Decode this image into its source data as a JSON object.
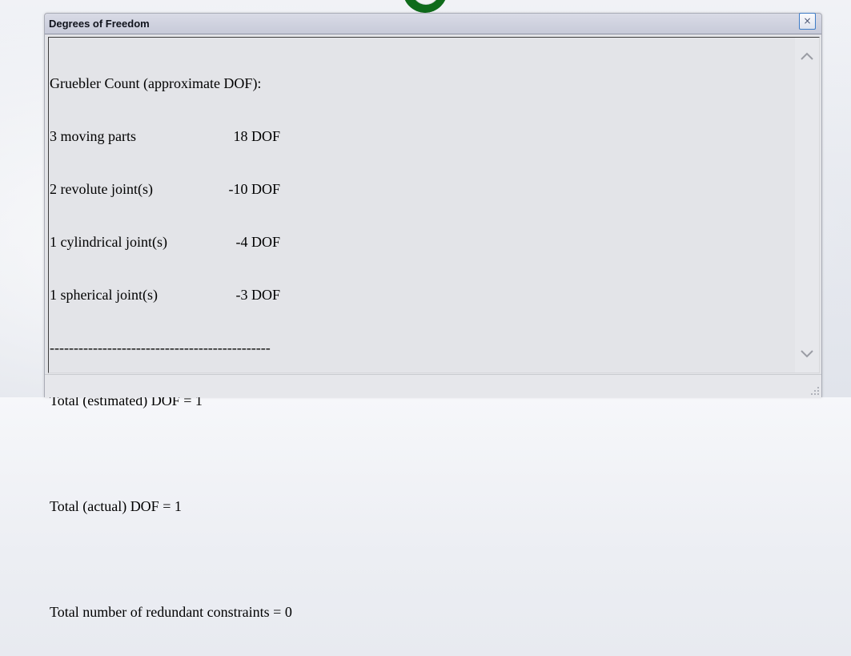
{
  "window": {
    "title": "Degrees of Freedom",
    "close_label": "×"
  },
  "report": {
    "header": "Gruebler Count (approximate DOF):",
    "rows": [
      {
        "label": "3 moving parts",
        "value": "18 DOF"
      },
      {
        "label": "2 revolute joint(s)",
        "value": "-10 DOF"
      },
      {
        "label": "1 cylindrical joint(s)",
        "value": "-4 DOF"
      },
      {
        "label": "1 spherical joint(s)",
        "value": "-3 DOF"
      }
    ],
    "separator": "----------------------------------------------",
    "estimated": "Total (estimated) DOF = 1",
    "actual": "Total (actual) DOF = 1",
    "redundant": "Total number of redundant constraints = 0"
  },
  "icons": {
    "scroll_up": "chevron-up-icon",
    "scroll_down": "chevron-down-icon",
    "resize": "resize-grip-icon",
    "close": "close-icon"
  },
  "colors": {
    "title_bar": "#c7cad9",
    "content_bg": "#e3e4e8",
    "close_border": "#3e7cc7",
    "bg_ring": "#0f6b1a"
  }
}
